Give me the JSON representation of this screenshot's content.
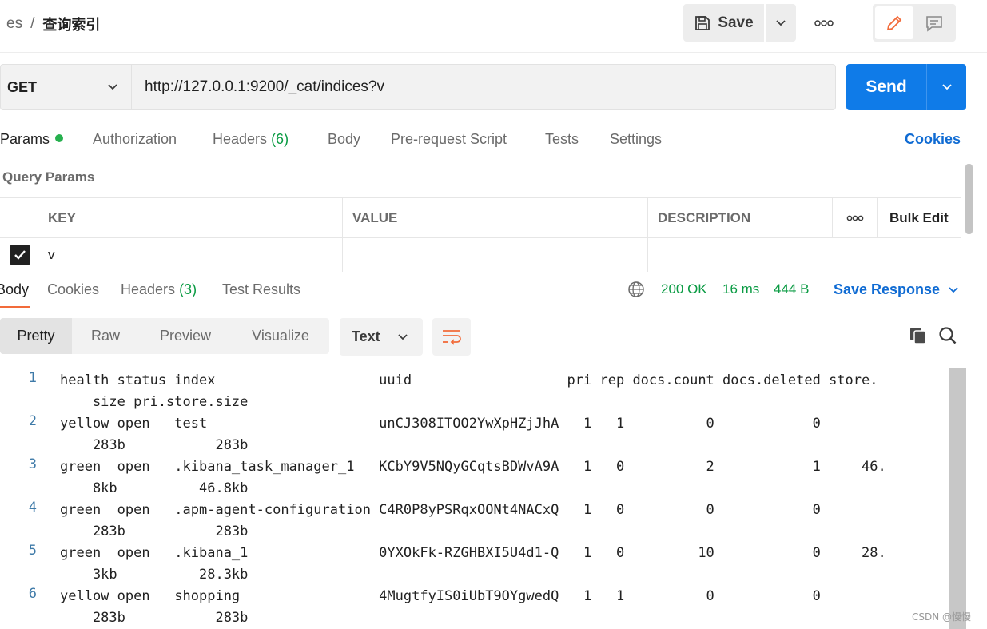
{
  "header": {
    "breadcrumb_parent": "es",
    "breadcrumb_sep": "/",
    "breadcrumb_current": "查询索引",
    "save_label": "Save"
  },
  "request": {
    "method": "GET",
    "url": "http://127.0.0.1:9200/_cat/indices?v",
    "send_label": "Send"
  },
  "request_tabs": {
    "params": "Params",
    "authorization": "Authorization",
    "headers": "Headers",
    "headers_count": "(6)",
    "body": "Body",
    "prerequest": "Pre-request Script",
    "tests": "Tests",
    "settings": "Settings",
    "cookies": "Cookies"
  },
  "query_params": {
    "title": "Query Params",
    "columns": {
      "key": "KEY",
      "value": "VALUE",
      "description": "DESCRIPTION",
      "bulk_edit": "Bulk Edit"
    },
    "rows": [
      {
        "checked": true,
        "key": "v",
        "value": "",
        "description": ""
      }
    ]
  },
  "response_tabs": {
    "body": "Body",
    "cookies": "Cookies",
    "headers": "Headers",
    "headers_count": "(3)",
    "test_results": "Test Results"
  },
  "response_status": {
    "status": "200 OK",
    "time": "16 ms",
    "size": "444 B",
    "save_response": "Save Response"
  },
  "view_modes": [
    "Pretty",
    "Raw",
    "Preview",
    "Visualize"
  ],
  "format": "Text",
  "body_lines": [
    {
      "n": "1",
      "a": "health status index                    uuid                   pri rep docs.count docs.deleted store.",
      "b": "    size pri.store.size"
    },
    {
      "n": "2",
      "a": "yellow open   test                     unCJ308ITOO2YwXpHZjJhA   1   1          0            0",
      "b": "    283b           283b"
    },
    {
      "n": "3",
      "a": "green  open   .kibana_task_manager_1   KCbY9V5NQyGCqtsBDWvA9A   1   0          2            1     46.",
      "b": "    8kb          46.8kb"
    },
    {
      "n": "4",
      "a": "green  open   .apm-agent-configuration C4R0P8yPSRqxOONt4NACxQ   1   0          0            0",
      "b": "    283b           283b"
    },
    {
      "n": "5",
      "a": "green  open   .kibana_1                0YXOkFk-RZGHBXI5U4d1-Q   1   0         10            0     28.",
      "b": "    3kb          28.3kb"
    },
    {
      "n": "6",
      "a": "yellow open   shopping                 4MugtfyIS0iUbT9OYgwedQ   1   1          0            0",
      "b": "    283b           283b"
    }
  ],
  "watermark": "CSDN @慢慢",
  "colors": {
    "send": "#0f7be8",
    "accent": "#f26b3a",
    "status_ok": "#0a9b43",
    "link": "#0f6bd3"
  }
}
